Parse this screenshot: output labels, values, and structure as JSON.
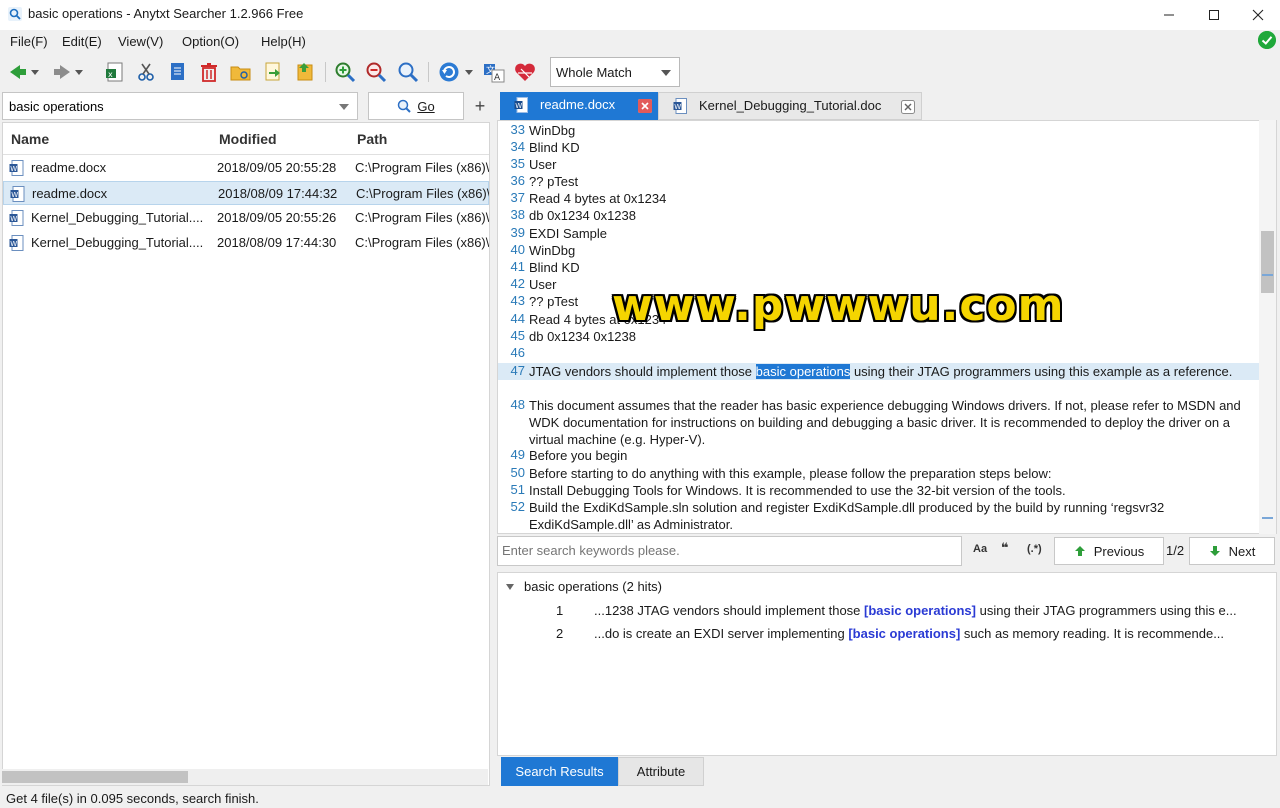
{
  "window": {
    "title": "basic operations - Anytxt Searcher 1.2.966 Free"
  },
  "menu": [
    "File(F)",
    "Edit(E)",
    "View(V)",
    "Option(O)",
    "Help(H)"
  ],
  "toolbar": {
    "match_mode": "Whole Match"
  },
  "search": {
    "query": "basic operations",
    "go_label": "Go"
  },
  "file_list": {
    "columns": [
      "Name",
      "Modified",
      "Path"
    ],
    "rows": [
      {
        "name": "readme.docx",
        "modified": "2018/09/05 20:55:28",
        "path": "C:\\Program Files (x86)\\"
      },
      {
        "name": "readme.docx",
        "modified": "2018/08/09 17:44:32",
        "path": "C:\\Program Files (x86)\\"
      },
      {
        "name": "Kernel_Debugging_Tutorial....",
        "modified": "2018/09/05 20:55:26",
        "path": "C:\\Program Files (x86)\\"
      },
      {
        "name": "Kernel_Debugging_Tutorial....",
        "modified": "2018/08/09 17:44:30",
        "path": "C:\\Program Files (x86)\\"
      }
    ]
  },
  "tabs": [
    {
      "label": "readme.docx",
      "active": true
    },
    {
      "label": "Kernel_Debugging_Tutorial.doc",
      "active": false
    }
  ],
  "document": {
    "lines": [
      {
        "n": "33",
        "text": "WinDbg"
      },
      {
        "n": "34",
        "text": "Blind KD"
      },
      {
        "n": "35",
        "text": "User"
      },
      {
        "n": "36",
        "text": "?? pTest"
      },
      {
        "n": "37",
        "text": "Read 4 bytes at 0x1234"
      },
      {
        "n": "38",
        "text": "db 0x1234 0x1238"
      },
      {
        "n": "39",
        "text": "EXDI Sample"
      },
      {
        "n": "40",
        "text": "WinDbg"
      },
      {
        "n": "41",
        "text": "Blind KD"
      },
      {
        "n": "42",
        "text": "User"
      },
      {
        "n": "43",
        "text": "?? pTest"
      },
      {
        "n": "44",
        "text": "Read 4 bytes at 0x1234"
      },
      {
        "n": "45",
        "text": "db 0x1234 0x1238"
      },
      {
        "n": "46",
        "text": ""
      },
      {
        "n": "47",
        "pre": "JTAG vendors should implement those ",
        "hl": "basic operations",
        "post": " using their JTAG programmers using this example as a reference."
      },
      {
        "n": "48",
        "text": "This document assumes that the reader has basic experience debugging Windows drivers. If not, please refer to MSDN and WDK documentation for instructions on building and debugging a basic driver. It is recommended to deploy the driver on a virtual machine (e.g. Hyper-V)."
      },
      {
        "n": "49",
        "text": "Before you begin"
      },
      {
        "n": "50",
        "text": "Before starting to do anything with this example, please follow the preparation steps below:"
      },
      {
        "n": "51",
        "text": "Install Debugging Tools for Windows. It is recommended to use the 32-bit version of the tools."
      },
      {
        "n": "52",
        "text": "Build the ExdiKdSample.sln solution and register ExdiKdSample.dll produced by the build by running ‘regsvr32 ExdiKdSample.dll’ as Administrator."
      }
    ],
    "watermark": "www.pwwwu.com"
  },
  "find_bar": {
    "placeholder": "Enter search keywords please.",
    "opt_case": "Aa",
    "opt_word": "❝",
    "opt_regex": "(.*)",
    "previous_label": "Previous",
    "next_label": "Next",
    "hit_count": "1/2"
  },
  "results": {
    "group_label": "basic operations (2 hits)",
    "hits": [
      {
        "n": "1",
        "pre": "...1238 JTAG vendors should implement those ",
        "kw": "[basic operations]",
        "post": " using their JTAG programmers using this e..."
      },
      {
        "n": "2",
        "pre": "...do is create an EXDI server implementing ",
        "kw": "[basic operations]",
        "post": " such as memory reading. It is recommende..."
      }
    ]
  },
  "bottom_tabs": [
    "Search Results",
    "Attribute"
  ],
  "status": "Get 4 file(s) in 0.095 seconds, search finish.",
  "colors": {
    "accent": "#1f78d4",
    "selection": "#dbeaf6",
    "keyword": "#2a3ad4",
    "watermark": "#f5d500"
  }
}
